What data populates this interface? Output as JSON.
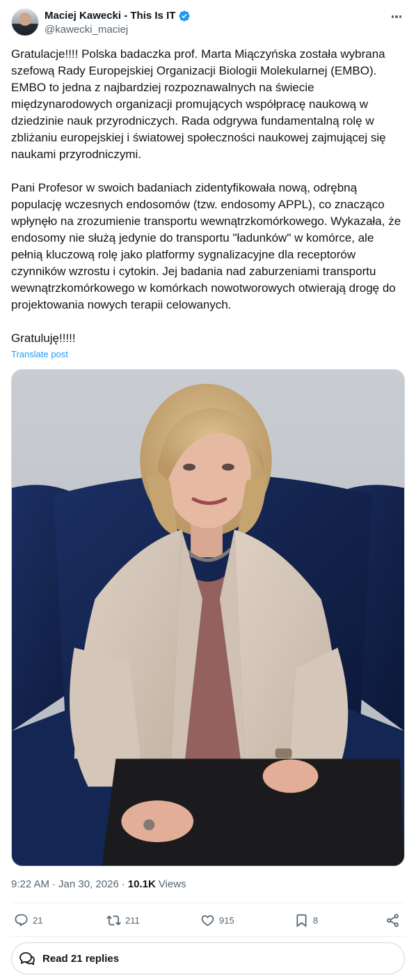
{
  "author": {
    "display_name": "Maciej Kawecki - This Is IT",
    "handle": "@kawecki_maciej",
    "verified": true
  },
  "post": {
    "text": "Gratulacje!!!! Polska badaczka prof. Marta Miączyńska została wybrana szefową Rady Europejskiej Organizacji Biologii Molekularnej (EMBO). EMBO to jedna z najbardziej rozpoznawalnych na świecie międzynarodowych organizacji promujących współpracę naukową w dziedzinie nauk przyrodniczych. Rada odgrywa fundamentalną rolę w zbliżaniu europejskiej i światowej społeczności naukowej zajmującej się naukami przyrodniczymi.\n\nPani Profesor w swoich badaniach zidentyfikowała nową, odrębną populację wczesnych endosomów (tzw. endosomy APPL), co znacząco wpłynęło na zrozumienie transportu wewnątrzkomórkowego. Wykazała, że endosomy nie służą jedynie do transportu \"ładunków\" w komórce, ale pełnią kluczową rolę jako platformy sygnalizacyjne dla receptorów czynników wzrostu i cytokin. Jej badania nad zaburzeniami transportu wewnątrzkomórkowego w komórkach nowotworowych otwierają drogę do projektowania nowych terapii celowanych.\n\nGratuluję!!!!!",
    "translate_label": "Translate post",
    "time": "9:22 AM",
    "date": "Jan 30, 2026",
    "separator": "·",
    "views_count": "10.1K",
    "views_label": "Views"
  },
  "actions": {
    "replies": "21",
    "reposts": "211",
    "likes": "915",
    "bookmarks": "8"
  },
  "read_replies_label": "Read 21 replies",
  "colors": {
    "accent": "#1d9bf0",
    "text": "#0f1419",
    "secondary": "#536471",
    "border": "#cfd9de"
  }
}
